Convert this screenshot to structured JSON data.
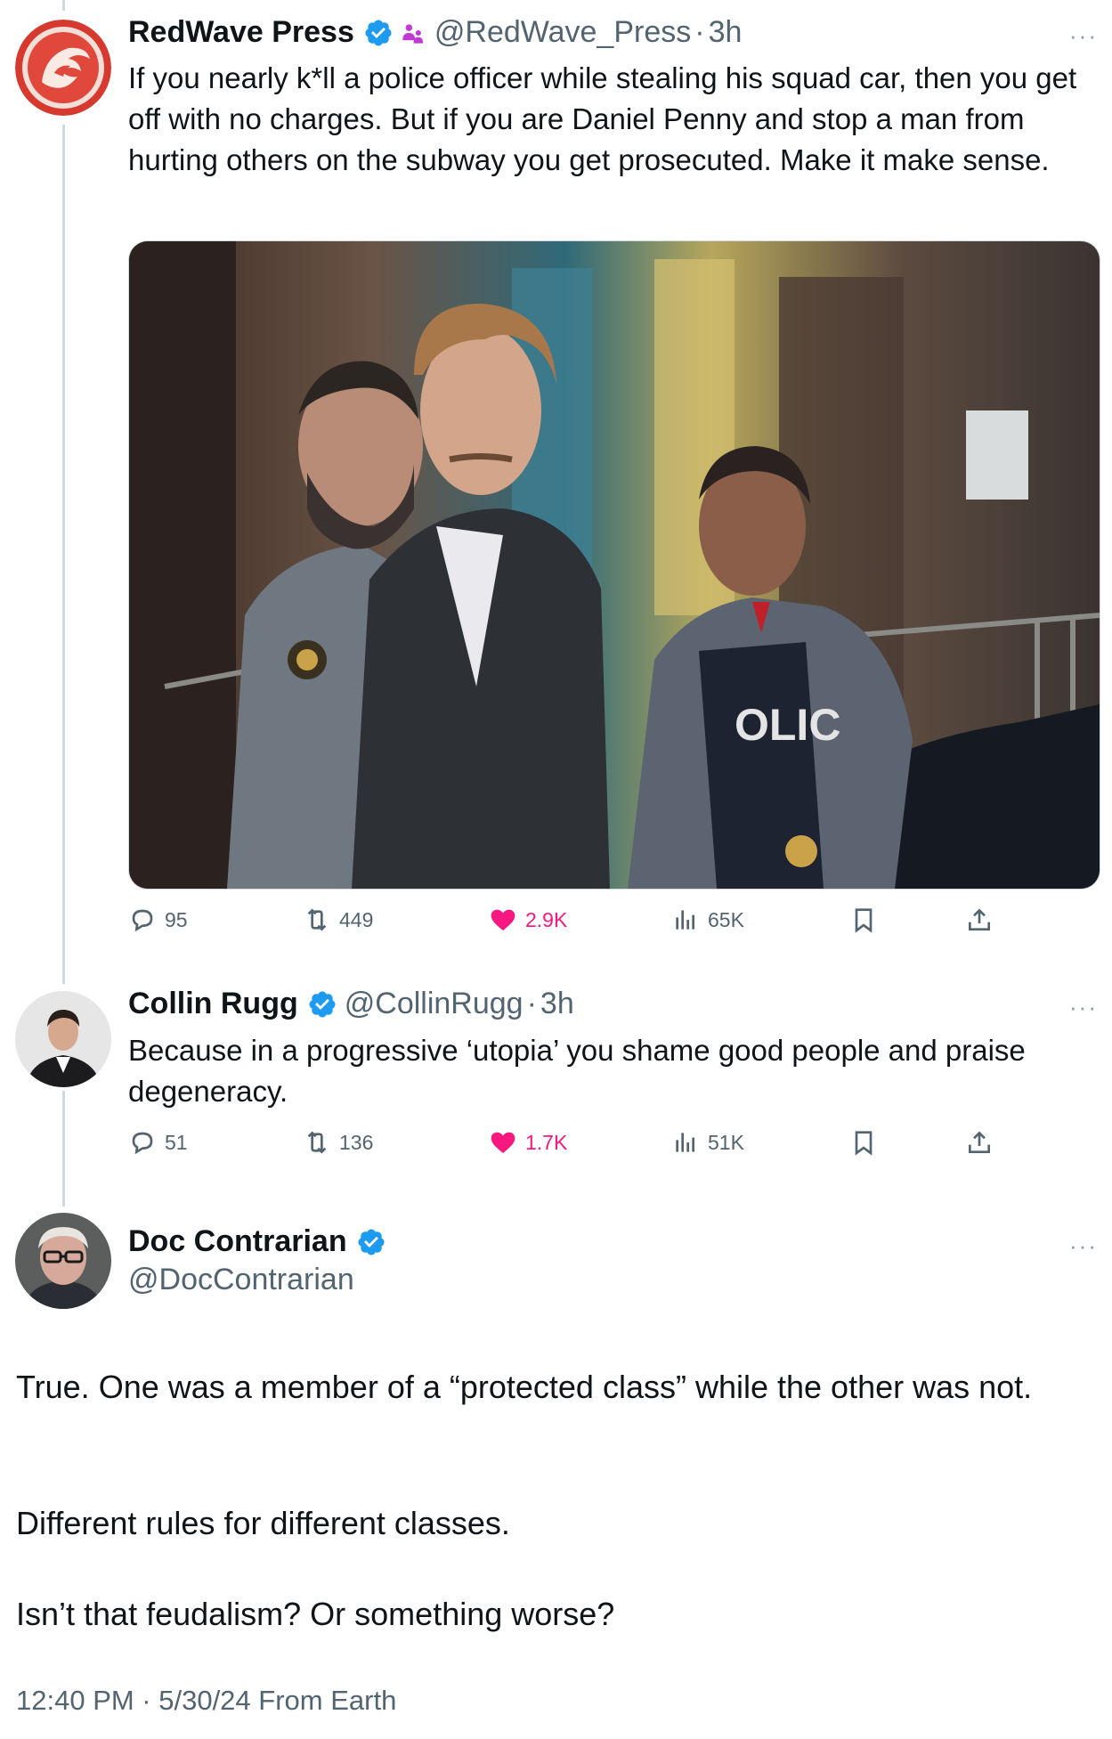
{
  "tweets": [
    {
      "name": "RedWave Press",
      "handle": "@RedWave_Press",
      "time": "3h",
      "text": "If you nearly k*ll a police officer while stealing his squad car, then you get off with no charges. But if you are Daniel Penny and stop a man from hurting others on the subway you get prosecuted. Make it make sense.",
      "stats": {
        "replies": "95",
        "reposts": "449",
        "likes": "2.9K",
        "views": "65K"
      }
    },
    {
      "name": "Collin Rugg",
      "handle": "@CollinRugg",
      "time": "3h",
      "text": "Because in a progressive ‘utopia’ you shame good people and praise degeneracy.",
      "stats": {
        "replies": "51",
        "reposts": "136",
        "likes": "1.7K",
        "views": "51K"
      }
    }
  ],
  "main": {
    "name": "Doc Contrarian",
    "handle": "@DocContrarian",
    "paragraphs": [
      "True. One was a member of a “protected class” while the other was not.",
      "Different rules for different classes.",
      "Isn’t that feudalism? Or something worse?"
    ],
    "timestamp": "12:40 PM · 5/30/24 From Earth"
  },
  "ui": {
    "separator": "·",
    "more": "···",
    "media_vest_text": "OLIC"
  },
  "colors": {
    "verified": "#1d9bf0",
    "like": "#f91880",
    "muted": "#536471",
    "thread_line": "#cfd9de",
    "affiliate_badge": "#c13ad6"
  },
  "icons": [
    "verified-icon",
    "affiliate-badge-icon",
    "reply-icon",
    "repost-icon",
    "like-icon",
    "views-icon",
    "bookmark-icon",
    "share-icon",
    "more-icon"
  ]
}
